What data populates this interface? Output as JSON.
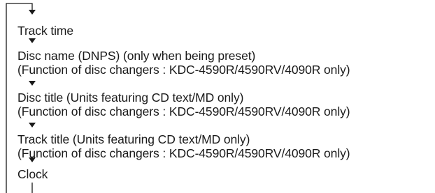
{
  "items": [
    {
      "lines": [
        "Track time"
      ]
    },
    {
      "lines": [
        "Disc name (DNPS) (only when being preset)",
        "(Function of disc changers : KDC-4590R/4590RV/4090R only)"
      ]
    },
    {
      "lines": [
        "Disc title (Units featuring CD text/MD only)",
        "(Function of disc changers : KDC-4590R/4590RV/4090R only)"
      ]
    },
    {
      "lines": [
        "Track title (Units featuring CD text/MD only)",
        "(Function of disc changers : KDC-4590R/4590RV/4090R only)"
      ]
    },
    {
      "lines": [
        "Clock"
      ]
    }
  ]
}
